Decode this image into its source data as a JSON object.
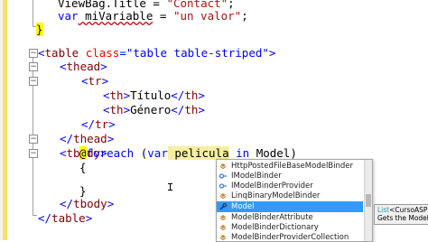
{
  "code": {
    "line1": {
      "a": "ViewBag.",
      "b": "Title",
      "c": " = ",
      "d": "\"Contact\"",
      "e": ";"
    },
    "line2": {
      "k": "var",
      "v": " miVariable",
      "eq": " = ",
      "s": "\"un valor\"",
      "e": ";"
    },
    "line3": "}",
    "line4": {
      "lt": "<",
      "tag": "table",
      "sp": " ",
      "attr": "class",
      "eq": "=",
      "val": "\"table table-striped\"",
      "gt": ">"
    },
    "line5": {
      "lt": "<",
      "tag": "thead",
      "gt": ">"
    },
    "line6": {
      "lt": "<",
      "tag": "tr",
      "gt": ">"
    },
    "line7": {
      "lt": "<",
      "tag": "th",
      "gt": ">",
      "text": "Título",
      "clt": "</",
      "ctag": "th",
      "cgt": ">"
    },
    "line8": {
      "lt": "<",
      "tag": "th",
      "gt": ">",
      "text": "Género",
      "clt": "</",
      "ctag": "th",
      "cgt": ">"
    },
    "line9": {
      "lt": "</",
      "tag": "tr",
      "gt": ">"
    },
    "line10": {
      "lt": "</",
      "tag": "thead",
      "gt": ">"
    },
    "line11": {
      "lt": "<",
      "tag": "tbody",
      "gt": ">"
    },
    "line12": {
      "at": "@",
      "kw": "foreach",
      "sp": " (",
      "var": "var",
      "ident": " pelicula",
      "in": " in",
      "model": " Model)"
    },
    "line13": "{",
    "line14": "}",
    "line15": {
      "lt": "</",
      "tag": "tbody",
      "gt": ">"
    },
    "line16": {
      "lt": "</",
      "tag": "table",
      "gt": ">"
    }
  },
  "intellisense": {
    "items": [
      {
        "label": "HttpPostedFileBaseModelBinder",
        "icon": "class-icon"
      },
      {
        "label": "IModelBinder",
        "icon": "interface-icon"
      },
      {
        "label": "IModelBinderProvider",
        "icon": "interface-icon"
      },
      {
        "label": "LinqBinaryModelBinder",
        "icon": "class-icon"
      },
      {
        "label": "Model",
        "icon": "wrench-icon",
        "selected": true
      },
      {
        "label": "ModelBinderAttribute",
        "icon": "class-icon"
      },
      {
        "label": "ModelBinderDictionary",
        "icon": "class-icon"
      },
      {
        "label": "ModelBinderProviderCollection",
        "icon": "class-icon"
      }
    ]
  },
  "tooltip": {
    "line1_type": "List",
    "line1_rest": "<CursoASPNE",
    "line2": "Gets the Model p"
  },
  "colors": {
    "keyword": "#0000ff",
    "string": "#a31515",
    "tag": "#800000",
    "attribute": "#ff0000",
    "selection": "#3399ff"
  }
}
